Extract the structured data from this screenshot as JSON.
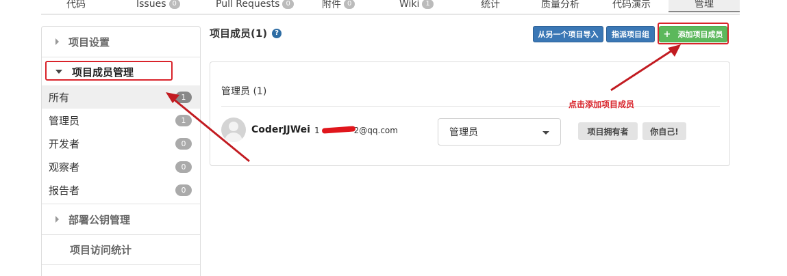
{
  "tabs": [
    {
      "label": "代码",
      "badge": ""
    },
    {
      "label": "Issues",
      "badge": "0"
    },
    {
      "label": "Pull Requests",
      "badge": "0"
    },
    {
      "label": "附件",
      "badge": "0"
    },
    {
      "label": "Wiki",
      "badge": "1"
    },
    {
      "label": "统计",
      "badge": ""
    },
    {
      "label": "质量分析",
      "badge": ""
    },
    {
      "label": "代码演示",
      "badge": ""
    },
    {
      "label": "管理",
      "badge": ""
    }
  ],
  "sidebar": {
    "project_settings": "项目设置",
    "member_management": "项目成员管理",
    "roles": [
      {
        "label": "所有",
        "count": "1"
      },
      {
        "label": "管理员",
        "count": "1"
      },
      {
        "label": "开发者",
        "count": "0"
      },
      {
        "label": "观察者",
        "count": "0"
      },
      {
        "label": "报告者",
        "count": "0"
      }
    ],
    "deploy_keys": "部署公钥管理",
    "access_stats": "项目访问统计"
  },
  "main": {
    "title": "项目成员(1)",
    "help_icon": "?",
    "import_button": "从另一个项目导入",
    "assign_group_button": "指派项目组",
    "add_member_button": "添加项目成员",
    "add_icon": "+"
  },
  "panel": {
    "group_title": "管理员 (1)",
    "member": {
      "name": "CoderJJWei",
      "email_prefix": "1",
      "email_suffix": "2@qq.com",
      "role": "管理员",
      "tags": [
        "项目拥有者",
        "你自己!"
      ]
    }
  },
  "annotation": {
    "note": "点击添加项目成员"
  },
  "colors": {
    "primary_blue": "#3a77b5",
    "success_green": "#5cb85c",
    "annotation_red": "#d9232a"
  }
}
